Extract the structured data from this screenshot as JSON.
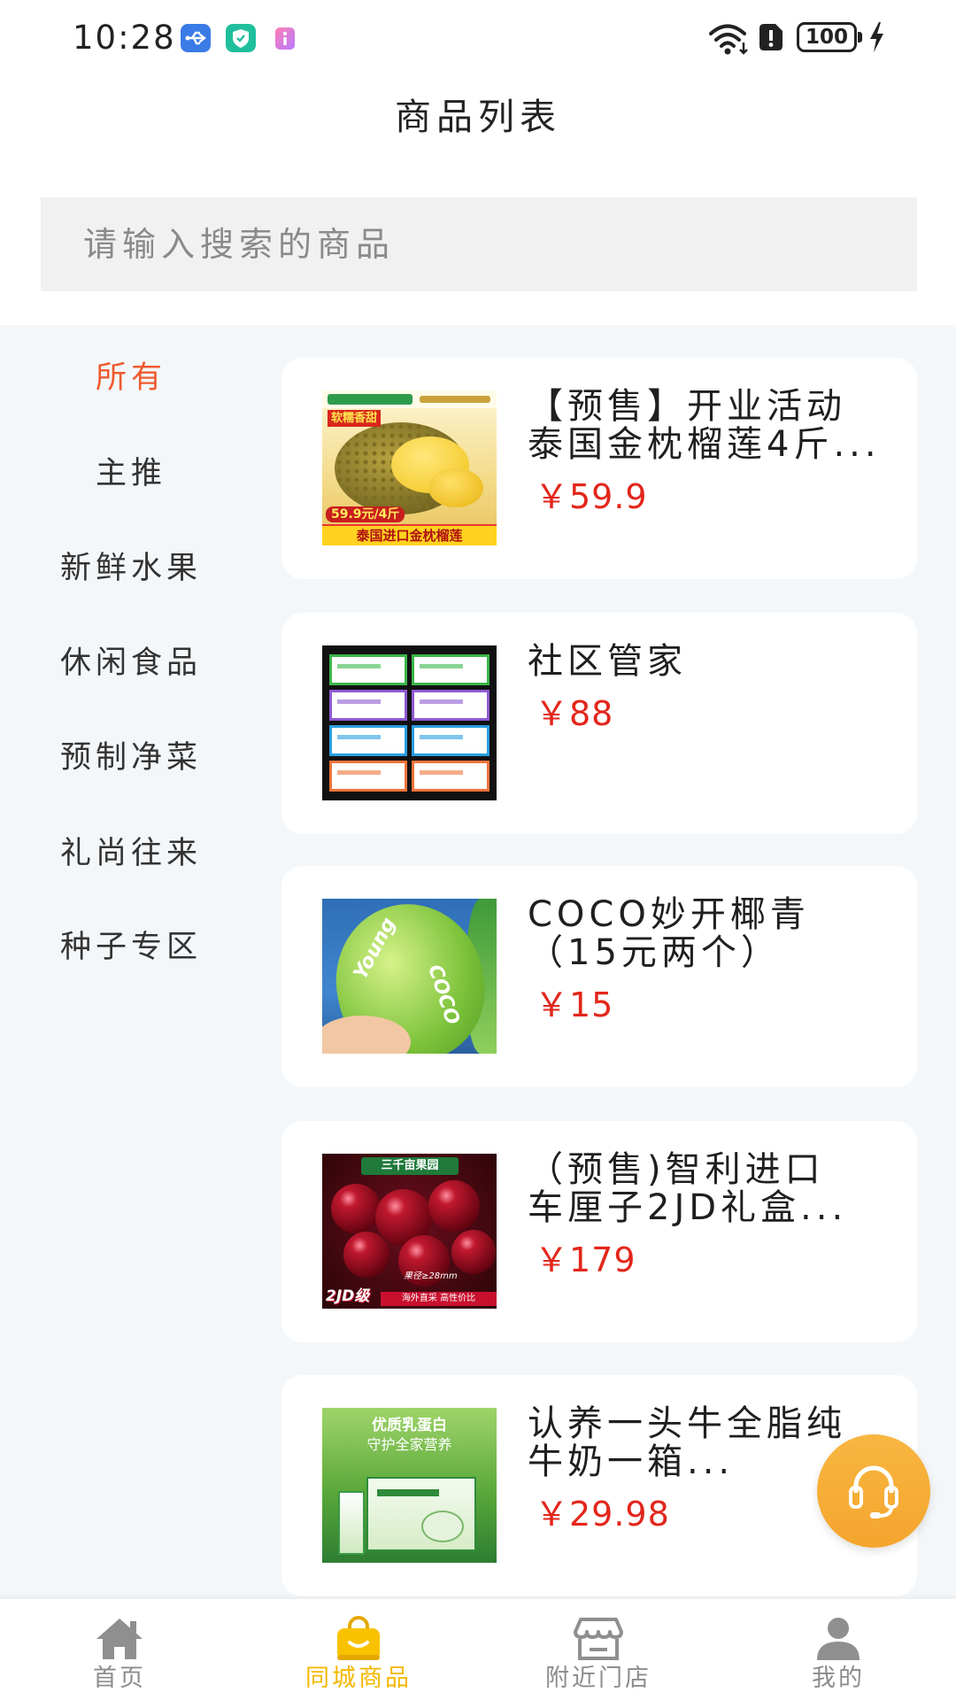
{
  "status_bar": {
    "time": "10:28",
    "battery": "100",
    "icons": [
      "usb-debug-icon",
      "security-shield-icon",
      "app-notification-icon",
      "wifi-icon",
      "sim-alert-icon",
      "battery-icon",
      "charging-bolt-icon"
    ]
  },
  "header": {
    "title": "商品列表"
  },
  "search": {
    "placeholder": "请输入搜索的商品",
    "value": ""
  },
  "categories": [
    {
      "label": "所有",
      "active": true
    },
    {
      "label": "主推",
      "active": false
    },
    {
      "label": "新鲜水果",
      "active": false
    },
    {
      "label": "休闲食品",
      "active": false
    },
    {
      "label": "预制净菜",
      "active": false
    },
    {
      "label": "礼尚往来",
      "active": false
    },
    {
      "label": "种子专区",
      "active": false
    }
  ],
  "products": [
    {
      "title_lines": [
        "【预售】开业活动",
        "泰国金枕榴莲4斤..."
      ],
      "price": "￥59.9",
      "image": {
        "icon": "durian-product-image",
        "badge": "软糯香甜",
        "price_tag": "59.9元/4斤",
        "banner": "泰国进口金枕榴莲"
      }
    },
    {
      "title_lines": [
        "社区管家"
      ],
      "price": "￥88",
      "image": {
        "icon": "voucher-product-image"
      }
    },
    {
      "title_lines": [
        "COCO妙开椰青",
        "（15元两个）"
      ],
      "price": "￥15",
      "image": {
        "icon": "coconut-product-image",
        "brand_text_1": "Young",
        "brand_text_2": "COCO"
      }
    },
    {
      "title_lines": [
        "（预售)智利进口",
        "车厘子2JD礼盒..."
      ],
      "price": "￥179",
      "image": {
        "icon": "cherry-product-image",
        "banner": "三千亩果园",
        "size_note": "果径≥28mm",
        "grade": "2JD级",
        "slogan": "海外直采 高性价比"
      }
    },
    {
      "title_lines": [
        "认养一头牛全脂纯",
        "牛奶一箱..."
      ],
      "price": "￥29.98",
      "image": {
        "icon": "milk-product-image",
        "line1": "优质乳蛋白",
        "line2": "守护全家营养"
      }
    }
  ],
  "bottom_nav": [
    {
      "label": "首页",
      "icon": "home-icon",
      "active": false
    },
    {
      "label": "同城商品",
      "icon": "shopping-bag-icon",
      "active": true
    },
    {
      "label": "附近门店",
      "icon": "store-icon",
      "active": false
    },
    {
      "label": "我的",
      "icon": "user-icon",
      "active": false
    }
  ],
  "float_button": {
    "icon": "customer-service-headset-icon"
  },
  "colors": {
    "category_active": "#ef5a2f",
    "price": "#e3261b",
    "nav_active": "#f5b800",
    "nav_inactive": "#8c8c8c",
    "float_button": "#f6ad35",
    "content_bg": "#f4f7fa",
    "search_bg": "#f1f1f1"
  }
}
